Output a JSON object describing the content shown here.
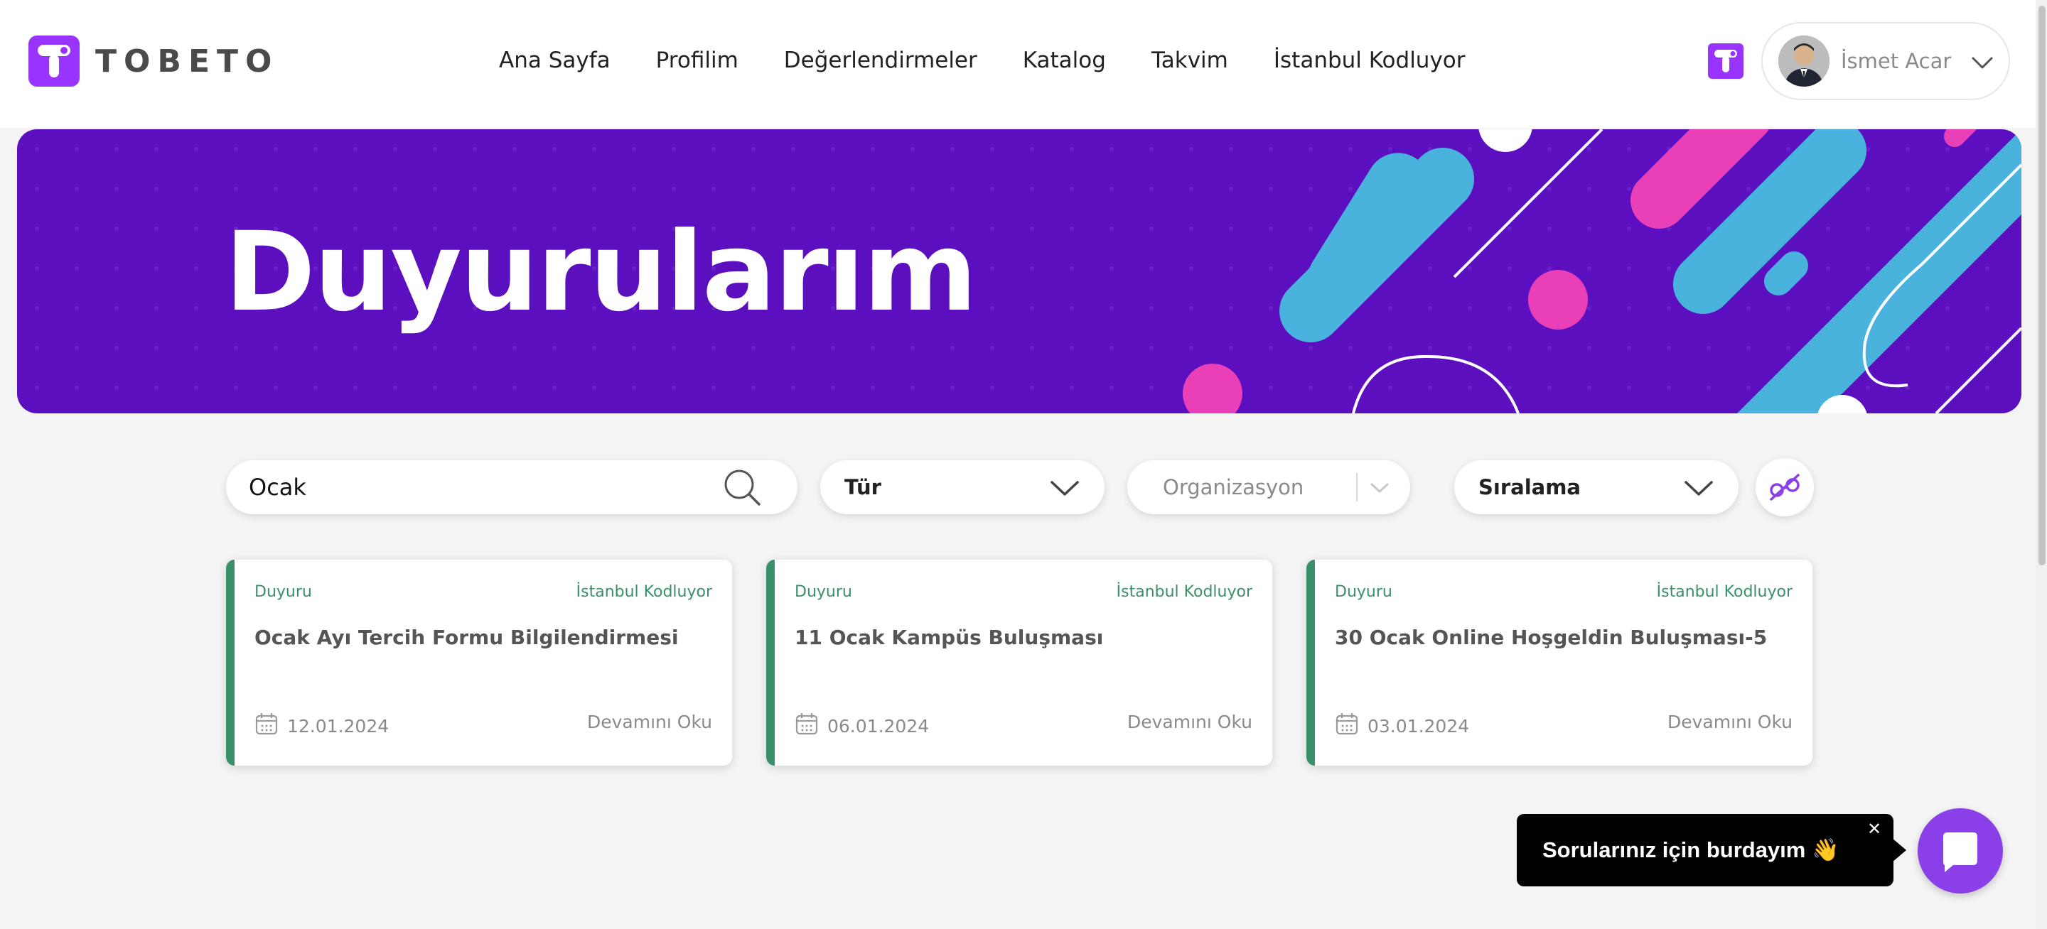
{
  "brand": {
    "name": "TOBETO",
    "accent": "#9933ff"
  },
  "nav": {
    "items": [
      "Ana Sayfa",
      "Profilim",
      "Değerlendirmeler",
      "Katalog",
      "Takvim",
      "İstanbul Kodluyor"
    ]
  },
  "user": {
    "name": "İsmet Acar",
    "menu_icon": "chevron-down-icon"
  },
  "banner": {
    "title": "Duyurularım",
    "background": "#5b0fbf"
  },
  "filters": {
    "search_value": "Ocak",
    "search_icon": "search-icon",
    "type_label": "Tür",
    "organization_placeholder": "Organizasyon",
    "sort_label": "Sıralama",
    "clear_icon": "filter-clear-icon"
  },
  "announcements": [
    {
      "type": "Duyuru",
      "organization": "İstanbul Kodluyor",
      "title": "Ocak Ayı Tercih Formu Bilgilendirmesi",
      "date": "12.01.2024",
      "more": "Devamını Oku"
    },
    {
      "type": "Duyuru",
      "organization": "İstanbul Kodluyor",
      "title": "11 Ocak Kampüs Buluşması",
      "date": "06.01.2024",
      "more": "Devamını Oku"
    },
    {
      "type": "Duyuru",
      "organization": "İstanbul Kodluyor",
      "title": "30 Ocak Online Hoşgeldin Buluşması-5",
      "date": "03.01.2024",
      "more": "Devamını Oku"
    }
  ],
  "chat": {
    "message": "Sorularınız için burdayım 👋",
    "close": "✕",
    "button_icon": "chat-icon"
  }
}
